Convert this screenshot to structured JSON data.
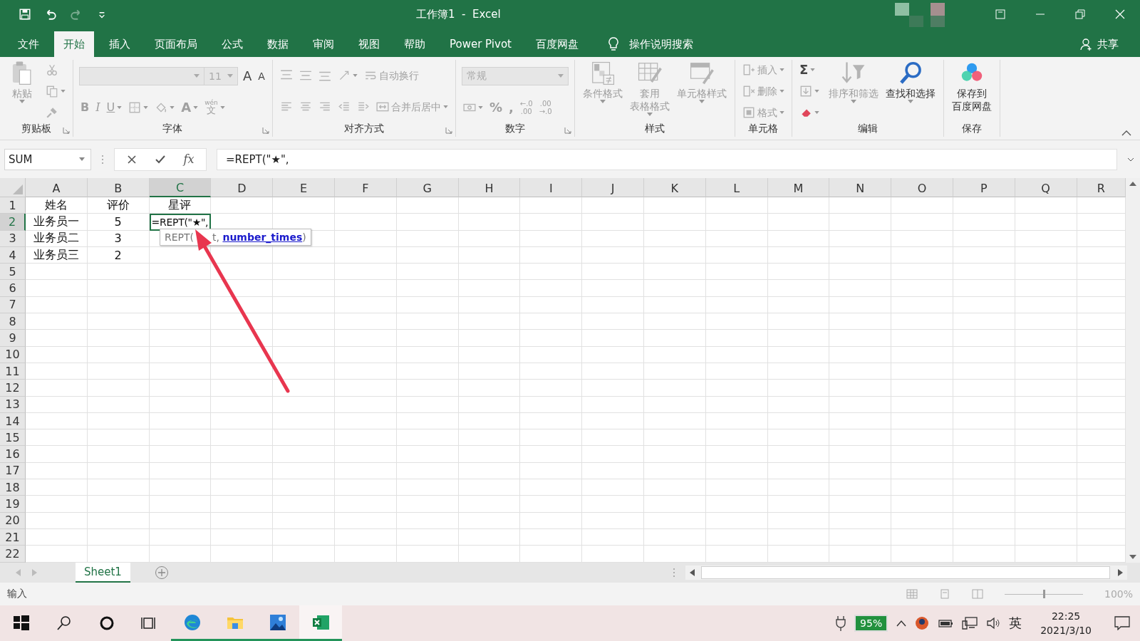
{
  "title_bar": {
    "title": "工作簿1  -  Excel"
  },
  "quick_access": [
    {
      "kind": "save",
      "disabled": false
    },
    {
      "kind": "undo",
      "disabled": false
    },
    {
      "kind": "redo",
      "disabled": true
    },
    {
      "kind": "customize",
      "disabled": false
    }
  ],
  "ribbon_tabs": [
    {
      "label": "文件",
      "selected": false
    },
    {
      "label": "开始",
      "selected": true
    },
    {
      "label": "插入",
      "selected": false
    },
    {
      "label": "页面布局",
      "selected": false
    },
    {
      "label": "公式",
      "selected": false
    },
    {
      "label": "数据",
      "selected": false
    },
    {
      "label": "审阅",
      "selected": false
    },
    {
      "label": "视图",
      "selected": false
    },
    {
      "label": "帮助",
      "selected": false
    },
    {
      "label": "Power Pivot",
      "selected": false
    },
    {
      "label": "百度网盘",
      "selected": false
    }
  ],
  "tell_me": {
    "label": "操作说明搜索"
  },
  "share": {
    "label": "共享"
  },
  "ribbon": {
    "groups": [
      {
        "label": "剪贴板",
        "launcher": true,
        "sections": [
          {
            "items": [
              {
                "kind": "paste",
                "label": "粘贴",
                "disabled": true
              }
            ]
          },
          {
            "lines": [
              {
                "items": [
                  {
                    "kind": "cut",
                    "disabled": true
                  }
                ]
              },
              {
                "items": [
                  {
                    "kind": "copy",
                    "disabled": true
                  }
                ]
              },
              {
                "items": [
                  {
                    "kind": "painter",
                    "disabled": true
                  }
                ]
              }
            ]
          }
        ]
      },
      {
        "label": "字体",
        "launcher": true,
        "sections": [
          {
            "lines": [
              {
                "items": [
                  {
                    "kind": "fontname",
                    "disabled": true
                  },
                  {
                    "kind": "fontsize",
                    "label": "11",
                    "disabled": true
                  },
                  {
                    "kind": "grow",
                    "label": "A",
                    "disabled": false
                  },
                  {
                    "kind": "shrink",
                    "label": "A",
                    "disabled": false
                  }
                ]
              },
              {
                "items": [
                  {
                    "kind": "bold",
                    "label": "B",
                    "disabled": true
                  },
                  {
                    "kind": "italic",
                    "label": "I",
                    "disabled": true
                  },
                  {
                    "kind": "underline",
                    "label": "U",
                    "disabled": true
                  },
                  {
                    "kind": "border",
                    "disabled": true
                  },
                  {
                    "kind": "fill",
                    "disabled": true
                  },
                  {
                    "kind": "fontcolor",
                    "label": "A",
                    "disabled": true
                  },
                  {
                    "kind": "phonetic",
                    "label": "文",
                    "ruby": "wén",
                    "disabled": true
                  }
                ]
              }
            ]
          }
        ]
      },
      {
        "label": "对齐方式",
        "launcher": true,
        "sections": [
          {
            "lines": [
              {
                "items": [
                  {
                    "kind": "top",
                    "disabled": true
                  },
                  {
                    "kind": "middle",
                    "disabled": true
                  },
                  {
                    "kind": "bottom",
                    "disabled": true
                  },
                  {
                    "kind": "orient",
                    "disabled": true
                  },
                  {
                    "kind": "wrap",
                    "label": "自动换行",
                    "disabled": true
                  }
                ]
              },
              {
                "items": [
                  {
                    "kind": "left",
                    "disabled": true
                  },
                  {
                    "kind": "center",
                    "disabled": true
                  },
                  {
                    "kind": "right",
                    "disabled": true
                  },
                  {
                    "kind": "outdent",
                    "disabled": true
                  },
                  {
                    "kind": "indent",
                    "disabled": true
                  },
                  {
                    "kind": "merge",
                    "label": "合并后居中",
                    "disabled": true
                  }
                ]
              }
            ]
          }
        ]
      },
      {
        "label": "数字",
        "launcher": true,
        "sections": [
          {
            "lines": [
              {
                "items": [
                  {
                    "kind": "numformat",
                    "label": "常规",
                    "disabled": true
                  }
                ]
              },
              {
                "items": [
                  {
                    "kind": "accounting",
                    "disabled": true
                  },
                  {
                    "kind": "percent",
                    "label": "%",
                    "disabled": true
                  },
                  {
                    "kind": "comma",
                    "label": ",",
                    "disabled": true
                  },
                  {
                    "kind": "incdec",
                    "label_lines": [
                      "←.0",
                      ".00"
                    ],
                    "disabled": true
                  },
                  {
                    "kind": "decdec",
                    "label_lines": [
                      ".00",
                      "→.0"
                    ],
                    "disabled": true
                  }
                ]
              }
            ]
          }
        ]
      },
      {
        "label": "样式",
        "sections": [
          {
            "items": [
              {
                "kind": "cond",
                "label": "条件格式",
                "disabled": true
              },
              {
                "kind": "table",
                "label_lines": [
                  "套用",
                  "表格格式"
                ],
                "disabled": true
              },
              {
                "kind": "cellstyle",
                "label": "单元格样式",
                "disabled": true
              }
            ]
          }
        ]
      },
      {
        "label": "单元格",
        "sections": [
          {
            "lines": [
              {
                "items": [
                  {
                    "kind": "insert",
                    "label": "插入",
                    "disabled": true
                  }
                ]
              },
              {
                "items": [
                  {
                    "kind": "delete",
                    "label": "删除",
                    "disabled": true
                  }
                ]
              },
              {
                "items": [
                  {
                    "kind": "format",
                    "label": "格式",
                    "disabled": true
                  }
                ]
              }
            ]
          }
        ]
      },
      {
        "label": "编辑",
        "sections": [
          {
            "lines": [
              {
                "items": [
                  {
                    "kind": "sum",
                    "label": "Σ",
                    "disabled": false
                  }
                ]
              },
              {
                "items": [
                  {
                    "kind": "filldown",
                    "disabled": true
                  }
                ]
              },
              {
                "items": [
                  {
                    "kind": "clear",
                    "disabled": false
                  }
                ]
              }
            ]
          },
          {
            "items": [
              {
                "kind": "sort",
                "label": "排序和筛选",
                "disabled": true
              },
              {
                "kind": "find",
                "label": "查找和选择",
                "disabled": false
              }
            ]
          }
        ]
      },
      {
        "label": "保存",
        "sections": [
          {
            "items": [
              {
                "kind": "baidu",
                "label_lines": [
                  "保存到",
                  "百度网盘"
                ],
                "disabled": false
              }
            ]
          }
        ]
      }
    ]
  },
  "formula_bar": {
    "name_box": "SUM",
    "fx": "fx",
    "formula": "=REPT(\"★\","
  },
  "columns": [
    {
      "label": "A",
      "selected": false
    },
    {
      "label": "B",
      "selected": false
    },
    {
      "label": "C",
      "selected": true
    },
    {
      "label": "D",
      "selected": false
    },
    {
      "label": "E",
      "selected": false
    },
    {
      "label": "F",
      "selected": false
    },
    {
      "label": "G",
      "selected": false
    },
    {
      "label": "H",
      "selected": false
    },
    {
      "label": "I",
      "selected": false
    },
    {
      "label": "J",
      "selected": false
    },
    {
      "label": "K",
      "selected": false
    },
    {
      "label": "L",
      "selected": false
    },
    {
      "label": "M",
      "selected": false
    },
    {
      "label": "N",
      "selected": false
    },
    {
      "label": "O",
      "selected": false
    },
    {
      "label": "P",
      "selected": false
    },
    {
      "label": "Q",
      "selected": false
    },
    {
      "label": "R",
      "selected": false
    }
  ],
  "rows": [
    {
      "label": "1",
      "selected": false,
      "cells": [
        {
          "text": "姓名",
          "active": false
        },
        {
          "text": "评价",
          "active": false
        },
        {
          "text": "星评",
          "active": false
        }
      ]
    },
    {
      "label": "2",
      "selected": true,
      "cells": [
        {
          "text": "业务员一",
          "active": false
        },
        {
          "text": "5",
          "active": false
        },
        {
          "text": "=REPT(\"★\",",
          "active": true
        }
      ]
    },
    {
      "label": "3",
      "selected": false,
      "cells": [
        {
          "text": "业务员二",
          "active": false
        },
        {
          "text": "3",
          "active": false
        }
      ]
    },
    {
      "label": "4",
      "selected": false,
      "cells": [
        {
          "text": "业务员三",
          "active": false
        },
        {
          "text": "2",
          "active": false
        }
      ]
    },
    {
      "label": "5",
      "selected": false
    },
    {
      "label": "6",
      "selected": false
    },
    {
      "label": "7",
      "selected": false
    },
    {
      "label": "8",
      "selected": false
    },
    {
      "label": "9",
      "selected": false
    },
    {
      "label": "10",
      "selected": false
    },
    {
      "label": "11",
      "selected": false
    },
    {
      "label": "12",
      "selected": false
    },
    {
      "label": "13",
      "selected": false
    },
    {
      "label": "14",
      "selected": false
    },
    {
      "label": "15",
      "selected": false
    },
    {
      "label": "16",
      "selected": false
    },
    {
      "label": "17",
      "selected": false
    },
    {
      "label": "18",
      "selected": false
    },
    {
      "label": "19",
      "selected": false
    },
    {
      "label": "20",
      "selected": false
    },
    {
      "label": "21",
      "selected": false
    },
    {
      "label": "22",
      "selected": false
    }
  ],
  "tooltip": {
    "function": "REPT(",
    "argument": "t,",
    "current_argument": "number_times",
    "close": ")"
  },
  "sheet_tabs": [
    {
      "label": "Sheet1",
      "selected": true
    }
  ],
  "status_bar": {
    "mode": "输入",
    "zoom": {
      "level": 0.5,
      "label": "100%"
    }
  },
  "taskbar": {
    "apps": [
      {
        "kind": "start",
        "running": false,
        "selected": false
      },
      {
        "kind": "search",
        "running": false,
        "selected": false
      },
      {
        "kind": "cortana",
        "running": false,
        "selected": false
      },
      {
        "kind": "taskview",
        "running": false,
        "selected": false
      },
      {
        "kind": "edge",
        "running": true,
        "selected": false
      },
      {
        "kind": "explorer",
        "running": true,
        "selected": false
      },
      {
        "kind": "photos",
        "running": true,
        "selected": false
      },
      {
        "kind": "excel",
        "running": true,
        "selected": true
      }
    ],
    "battery": "95%",
    "ime": "英",
    "time": "22:25",
    "date": "2021/3/10"
  }
}
